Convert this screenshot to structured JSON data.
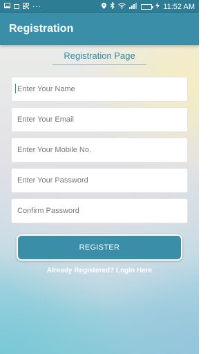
{
  "status_bar": {
    "time": "11:52 AM",
    "icons": [
      "gallery-icon",
      "square-icon",
      "qr-icon",
      "more-dots-icon",
      "location-icon",
      "bluetooth-icon",
      "wifi-icon",
      "signal-icon",
      "battery-icon",
      "charging-icon"
    ],
    "more_dots": "···"
  },
  "app_bar": {
    "title": "Registration"
  },
  "page": {
    "heading": "Registration Page"
  },
  "form": {
    "fields": [
      {
        "placeholder": "Enter Your Name",
        "value": ""
      },
      {
        "placeholder": "Enter Your Email",
        "value": ""
      },
      {
        "placeholder": "Enter Your Mobile No.",
        "value": ""
      },
      {
        "placeholder": "Enter Your Password",
        "value": ""
      },
      {
        "placeholder": "Confirm Password",
        "value": ""
      }
    ],
    "register_label": "REGISTER",
    "login_link": "Already Registered? Login Here"
  },
  "colors": {
    "primary": "#3b8ea8",
    "status_bar": "#2f7c95",
    "heading_text": "#2a8aa6"
  }
}
